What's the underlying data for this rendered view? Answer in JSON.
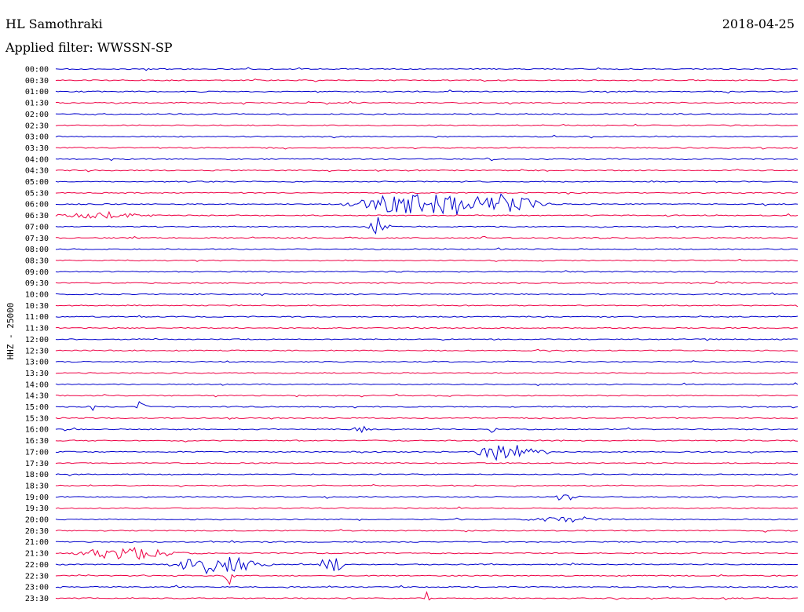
{
  "header": {
    "station": "HL Samothraki",
    "date": "2018-04-25",
    "filter_label": "Applied filter: WWSSN-SP",
    "channel_label": "HHZ - 25000"
  },
  "colors": {
    "trace_a": "#0000cc",
    "trace_b": "#ee0044"
  },
  "chart_data": {
    "type": "line",
    "title": "HL Samothraki",
    "subtitle": "Applied filter: WWSSN-SP",
    "ylabel": "HHZ - 25000",
    "xlabel": "",
    "grid": false,
    "legend": "none",
    "date": "2018-04-25",
    "row_labels": [
      "00:00",
      "00:30",
      "01:00",
      "01:30",
      "02:00",
      "02:30",
      "03:00",
      "03:30",
      "04:00",
      "04:30",
      "05:00",
      "05:30",
      "06:00",
      "06:30",
      "07:00",
      "07:30",
      "08:00",
      "08:30",
      "09:00",
      "09:30",
      "10:00",
      "10:30",
      "11:00",
      "11:30",
      "12:00",
      "12:30",
      "13:00",
      "13:30",
      "14:00",
      "14:30",
      "15:00",
      "15:30",
      "16:00",
      "16:30",
      "17:00",
      "17:30",
      "18:00",
      "18:30",
      "19:00",
      "19:30",
      "20:00",
      "20:30",
      "21:00",
      "21:30",
      "22:00",
      "22:30",
      "23:00",
      "23:30"
    ],
    "row_minutes": 30,
    "row_colors": [
      "trace_a",
      "trace_b"
    ],
    "events": [
      {
        "row": "06:00",
        "start_min": 11.5,
        "end_min": 19.5,
        "peak": 1.0
      },
      {
        "row": "06:00",
        "start_min": 16.8,
        "end_min": 20.0,
        "peak": 0.55
      },
      {
        "row": "06:30",
        "start_min": 0.0,
        "end_min": 4.2,
        "peak": 0.25
      },
      {
        "row": "07:00",
        "start_min": 12.5,
        "end_min": 13.5,
        "peak": 0.8
      },
      {
        "row": "15:00",
        "start_min": 1.3,
        "end_min": 1.6,
        "peak": 0.5
      },
      {
        "row": "15:00",
        "start_min": 3.2,
        "end_min": 3.8,
        "peak": 0.5
      },
      {
        "row": "16:00",
        "start_min": 12.0,
        "end_min": 12.8,
        "peak": 0.35
      },
      {
        "row": "16:00",
        "start_min": 17.3,
        "end_min": 18.0,
        "peak": 0.2
      },
      {
        "row": "17:00",
        "start_min": 16.8,
        "end_min": 20.0,
        "peak": 0.8
      },
      {
        "row": "19:00",
        "start_min": 20.2,
        "end_min": 21.2,
        "peak": 0.4
      },
      {
        "row": "20:00",
        "start_min": 19.0,
        "end_min": 23.0,
        "peak": 0.2
      },
      {
        "row": "21:30",
        "start_min": 0.6,
        "end_min": 6.0,
        "peak": 0.45
      },
      {
        "row": "22:00",
        "start_min": 4.4,
        "end_min": 9.0,
        "peak": 0.7
      },
      {
        "row": "22:00",
        "start_min": 10.6,
        "end_min": 11.8,
        "peak": 0.9
      },
      {
        "row": "22:30",
        "start_min": 6.8,
        "end_min": 7.3,
        "peak": 0.9
      },
      {
        "row": "23:30",
        "start_min": 14.9,
        "end_min": 15.1,
        "peak": 0.6
      }
    ]
  }
}
